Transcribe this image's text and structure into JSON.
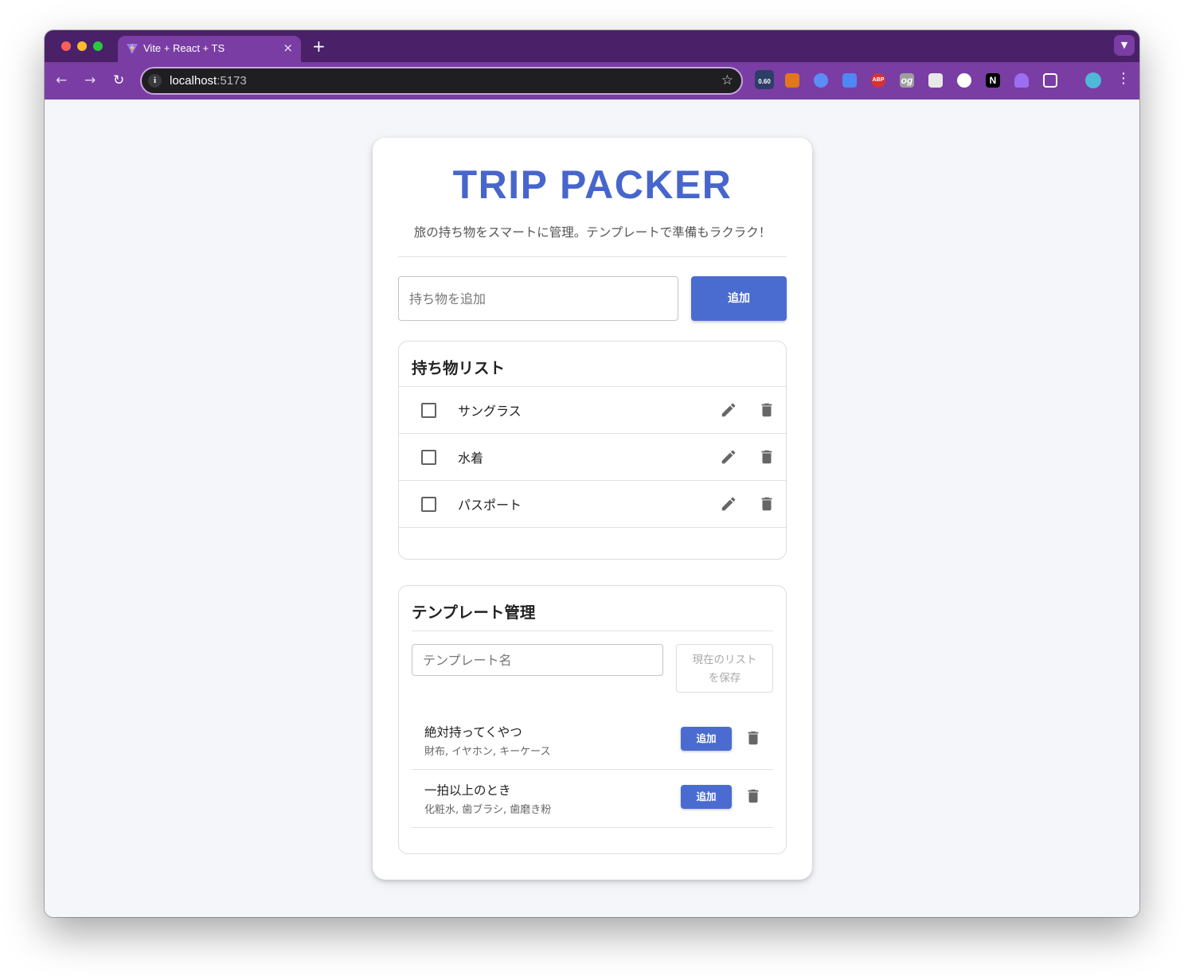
{
  "browser": {
    "tab_title": "Vite + React + TS",
    "tab_close": "×",
    "new_tab": "+",
    "url_host": "localhost",
    "url_port": ":5173",
    "ext_badge": "0.60",
    "ext_abp": "ABP",
    "ext_og": "og",
    "ext_n": "N"
  },
  "app": {
    "title": "TRIP PACKER",
    "subtitle": "旅の持ち物をスマートに管理。テンプレートで準備もラクラク！",
    "add_placeholder": "持ち物を追加",
    "add_button": "追加"
  },
  "packing_list": {
    "heading": "持ち物リスト",
    "items": [
      {
        "label": "サングラス",
        "checked": false
      },
      {
        "label": "水着",
        "checked": false
      },
      {
        "label": "パスポート",
        "checked": false
      }
    ]
  },
  "templates": {
    "heading": "テンプレート管理",
    "name_placeholder": "テンプレート名",
    "save_button_line1": "現在のリスト",
    "save_button_line2": "を保存",
    "list": [
      {
        "name": "絶対持ってくやつ",
        "items": "財布, イヤホン, キーケース",
        "add_label": "追加"
      },
      {
        "name": "一拍以上のとき",
        "items": "化粧水, 歯ブラシ, 歯磨き粉",
        "add_label": "追加"
      }
    ]
  },
  "colors": {
    "accent": "#4a6bd0",
    "title": "#4766cc",
    "browser_frame": "#7a3da3"
  },
  "icons": [
    "pencil-icon",
    "trash-icon",
    "star-icon",
    "info-icon"
  ]
}
